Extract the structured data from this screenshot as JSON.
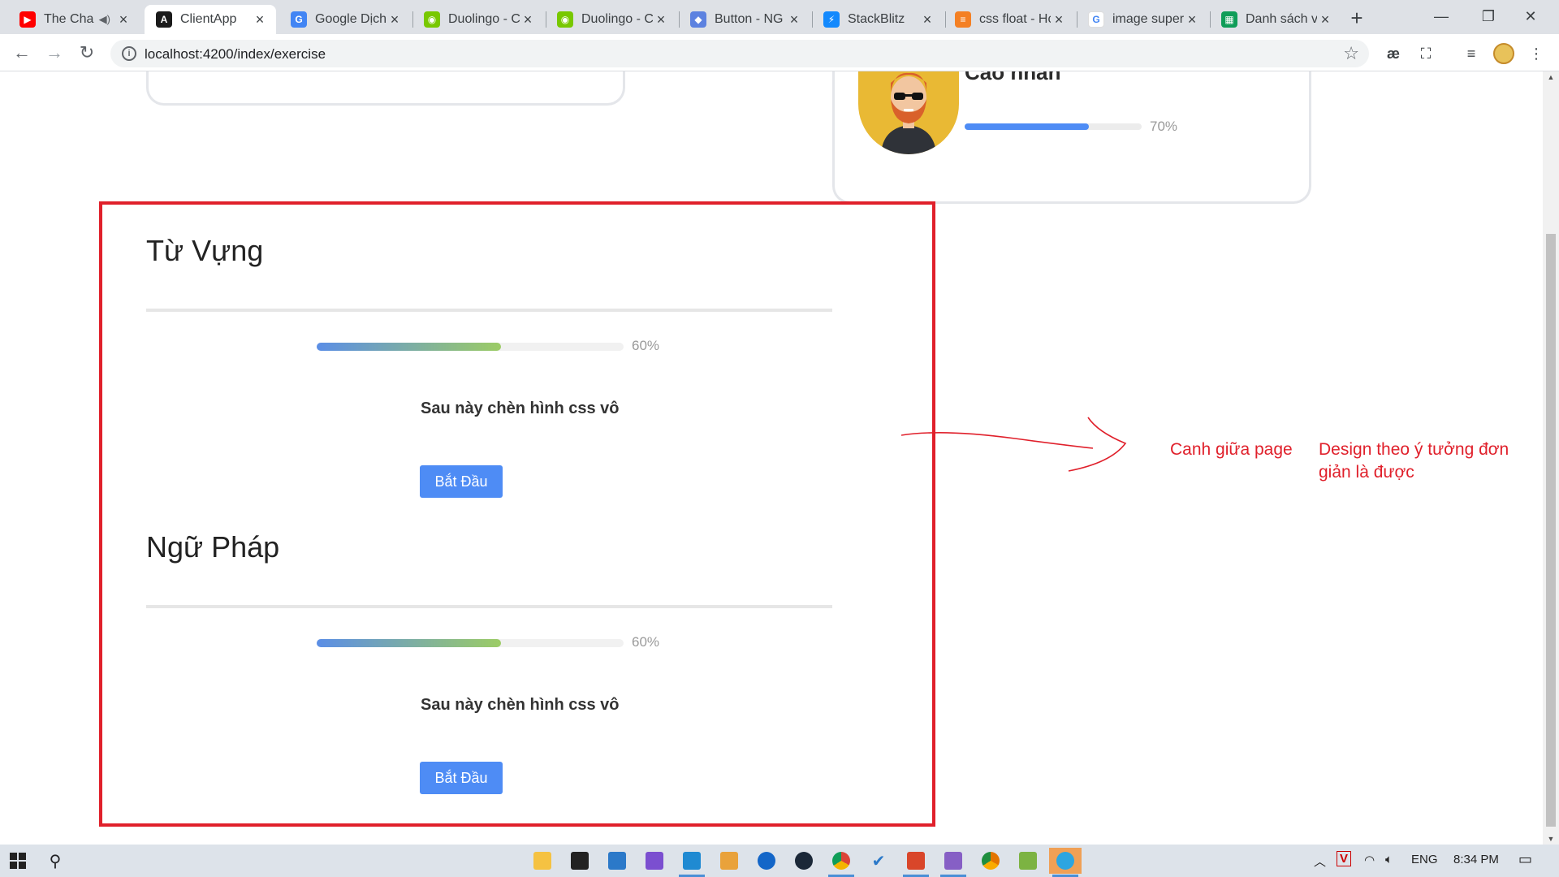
{
  "browser": {
    "tabs": [
      {
        "title": "The Cha",
        "icon": "youtube-icon",
        "color": "#ff0000",
        "glyph": "▶",
        "audio": true
      },
      {
        "title": "ClientApp",
        "icon": "angular-icon",
        "color": "#1a1a1a",
        "glyph": "A",
        "active": true
      },
      {
        "title": "Google Dịch",
        "icon": "google-translate-icon",
        "color": "#4285f4",
        "glyph": "G"
      },
      {
        "title": "Duolingo - C",
        "icon": "duolingo-icon",
        "color": "#78c800",
        "glyph": "◉"
      },
      {
        "title": "Duolingo - C",
        "icon": "duolingo-icon",
        "color": "#78c800",
        "glyph": "◉"
      },
      {
        "title": "Button - NG",
        "icon": "ng-zorro-icon",
        "color": "#5d82e0",
        "glyph": "◆"
      },
      {
        "title": "StackBlitz",
        "icon": "stackblitz-icon",
        "color": "#1389fd",
        "glyph": "⚡"
      },
      {
        "title": "css float - Hc",
        "icon": "stackoverflow-icon",
        "color": "#f48024",
        "glyph": "≡"
      },
      {
        "title": "image super",
        "icon": "google-icon",
        "color": "#ffffff",
        "glyph": "G"
      },
      {
        "title": "Danh sách v",
        "icon": "sheets-icon",
        "color": "#0f9d58",
        "glyph": "▦"
      }
    ],
    "url": "localhost:4200/index/exercise"
  },
  "profile": {
    "name": "Cao nhân",
    "progress": 0.7,
    "progress_label": "70%"
  },
  "sections": [
    {
      "title": "Từ Vựng",
      "progress": 0.6,
      "progress_label": "60%",
      "placeholder": "Sau này chèn hình css vô",
      "button": "Bắt Đầu"
    },
    {
      "title": "Ngữ Pháp",
      "progress": 0.6,
      "progress_label": "60%",
      "placeholder": "Sau này chèn hình css vô",
      "button": "Bắt Đầu"
    }
  ],
  "annotations": {
    "center_note": "Canh giữa page",
    "design_note_line1": "Design theo ý tưởng đơn",
    "design_note_line2": "giản là được",
    "color": "#e0202b"
  },
  "taskbar": {
    "language": "ENG",
    "time": "8:34 PM"
  }
}
